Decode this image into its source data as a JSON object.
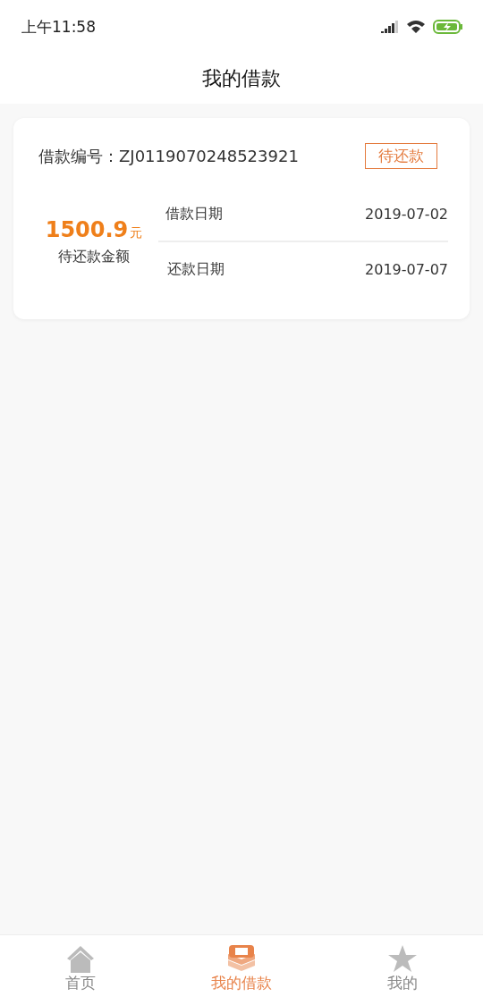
{
  "status_bar": {
    "time": "上午11:58"
  },
  "header": {
    "title": "我的借款"
  },
  "loan_card": {
    "number_label": "借款编号：",
    "number": "ZJ0119070248523921",
    "status": "待还款",
    "amount": "1500.9",
    "amount_unit": "元",
    "amount_label": "待还款金额",
    "dates": [
      {
        "label": "借款日期",
        "value": "2019-07-02"
      },
      {
        "label": "还款日期",
        "value": "2019-07-07"
      }
    ]
  },
  "tab_bar": [
    {
      "kind": "home",
      "label": "首页",
      "selected": false
    },
    {
      "kind": "loans",
      "label": "我的借款",
      "selected": true
    },
    {
      "kind": "profile",
      "label": "我的",
      "selected": false
    }
  ]
}
